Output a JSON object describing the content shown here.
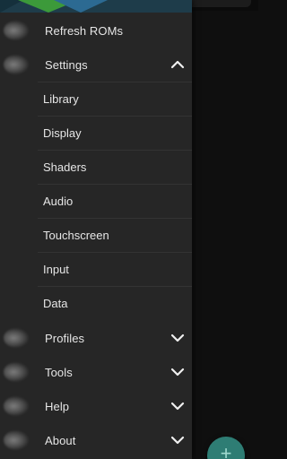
{
  "drawer": {
    "items": [
      {
        "label": "Refresh ROMs",
        "icon": "refresh-icon"
      },
      {
        "label": "Settings",
        "icon": "settings-icon",
        "expanded": true
      },
      {
        "label": "Profiles",
        "icon": "profiles-icon",
        "expanded": false
      },
      {
        "label": "Tools",
        "icon": "tools-icon",
        "expanded": false
      },
      {
        "label": "Help",
        "icon": "help-icon",
        "expanded": false
      },
      {
        "label": "About",
        "icon": "about-icon",
        "expanded": false
      }
    ],
    "settings_sub": [
      {
        "label": "Library"
      },
      {
        "label": "Display"
      },
      {
        "label": "Shaders"
      },
      {
        "label": "Audio"
      },
      {
        "label": "Touchscreen"
      },
      {
        "label": "Input"
      },
      {
        "label": "Data"
      }
    ]
  },
  "fab": {
    "icon": "add-icon",
    "glyph": "+"
  },
  "colors": {
    "drawer_bg": "#262626",
    "divider": "#333333",
    "text": "#e6e6e6",
    "fab": "#2e7d74",
    "header_green": "#3c9a3a",
    "header_blue": "#2c6a92"
  }
}
